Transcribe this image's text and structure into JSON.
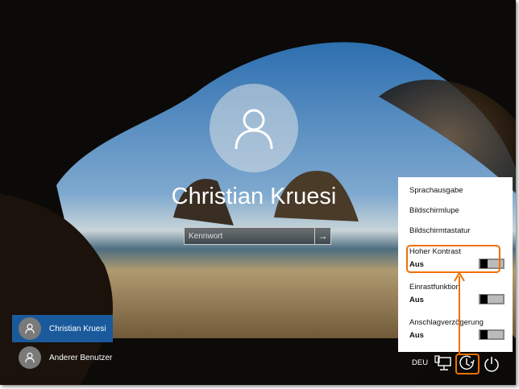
{
  "login": {
    "username": "Christian Kruesi",
    "password_placeholder": "Kennwort",
    "submit_icon": "arrow-right-icon"
  },
  "users": [
    {
      "name": "Christian Kruesi",
      "selected": true
    },
    {
      "name": "Anderer Benutzer",
      "selected": false
    }
  ],
  "ease_of_access": {
    "items": [
      "Sprachausgabe",
      "Bildschirmlupe",
      "Bildschirmtastatur"
    ],
    "toggles": [
      {
        "label": "Hoher Kontrast",
        "state": "Aus"
      },
      {
        "label": "Einrastfunktion",
        "state": "Aus"
      },
      {
        "label": "Anschlagverzögerung",
        "state": "Aus"
      }
    ]
  },
  "taskbar": {
    "language": "DEU",
    "icons": [
      "network-icon",
      "ease-of-access-icon",
      "power-icon"
    ]
  },
  "colors": {
    "accent": "#1a5a9c",
    "highlight": "#f07000"
  }
}
